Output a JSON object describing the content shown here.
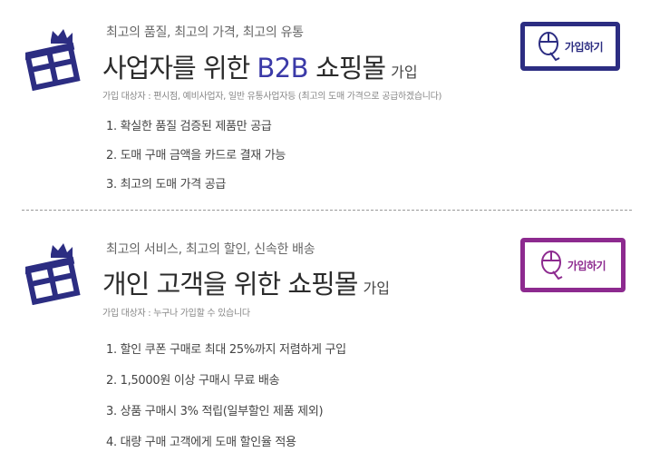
{
  "b2b": {
    "tagline": "최고의 품질, 최고의 가격, 최고의 유통",
    "title_main": "사업자를 위한",
    "title_highlight": "B2B",
    "title_mall": "쇼핑몰",
    "title_join": "가입",
    "target": "가입 대상자 : 편시점, 예비사업자, 일반 유통사업자등 (최고의 도매 가격으로 공급하겠습니다)",
    "features": [
      "1. 확실한 품질 검증된 제품만 공급",
      "2. 도매 구매 금액을 카드로 결재 가능",
      "3. 최고의 도매 가격 공급"
    ],
    "button_label": "가입하기",
    "accent": "#2c2d82"
  },
  "b2c": {
    "tagline": "최고의 서비스, 최고의 할인, 신속한 배송",
    "title_main": "개인 고객을 위한 쇼핑몰",
    "title_join": "가입",
    "target": "가입 대상자 : 누구나 가입할 수 있습니다",
    "features": [
      "1. 할인 쿠폰 구매로 최대 25%까지 저렴하게 구입",
      "2. 1,5000원 이상 구매시 무료 배송",
      "3. 상품 구매시 3% 적립(일부할인 제품 제외)",
      "4. 대량 구매 고객에게 도매 할인율 적용"
    ],
    "button_label": "가입하기",
    "accent": "#8d2a8f"
  },
  "icons": {
    "gift": "gift-box-with-crown-icon",
    "button": "mouse-pointer-icon"
  }
}
